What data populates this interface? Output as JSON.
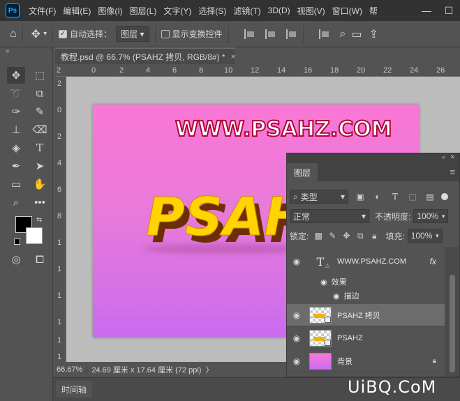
{
  "app": {
    "logo_text": "Ps"
  },
  "menubar": {
    "items": [
      "文件(F)",
      "编辑(E)",
      "图像(I)",
      "图层(L)",
      "文字(Y)",
      "选择(S)",
      "滤镜(T)",
      "3D(D)",
      "视图(V)",
      "窗口(W)",
      "帮"
    ],
    "window_controls": {
      "minimize": "—",
      "maximize": "☐"
    }
  },
  "options": {
    "home_icon": "home-icon",
    "move_icon": "move-icon",
    "auto_select_label": "自动选择：",
    "auto_select_checked": true,
    "auto_select_target": "图层",
    "show_transform_label": "显示变换控件",
    "show_transform_checked": false
  },
  "document": {
    "tab_title": "教程.psd @ 66.7% (PSAHZ 拷贝, RGB/8#) *",
    "close_glyph": "×",
    "ruler_top": [
      "2",
      "0",
      "2",
      "4",
      "6",
      "8",
      "10",
      "12",
      "14",
      "16",
      "18",
      "20",
      "22",
      "24",
      "26"
    ],
    "ruler_left": [
      "2",
      "0",
      "2",
      "4",
      "6",
      "8",
      "1",
      "1",
      "1",
      "1",
      "1",
      "1"
    ],
    "canvas": {
      "web_text": "WWW.PSAHZ.COM",
      "logo_text": "PSAHZ",
      "colors": {
        "pink_top": "#fa78d6",
        "purple_bottom": "#ca6bef",
        "gold": "#ffd400",
        "stroke": "#b0053a"
      }
    }
  },
  "status": {
    "zoom": "66.67%",
    "dimensions": "24.69 厘米 x 17.64 厘米 (72 ppi)",
    "arrow": "〉"
  },
  "timeline": {
    "tab_label": "时间轴"
  },
  "layers_panel": {
    "tab_label": "图层",
    "filter_kind": "类型",
    "blend_mode": "正常",
    "opacity_label": "不透明度:",
    "opacity_value": "100%",
    "lock_label": "锁定:",
    "fill_label": "填充:",
    "fill_value": "100%",
    "layers": [
      {
        "name": "WWW.PSAHZ.COM",
        "kind": "text",
        "visible": true,
        "fx": "fx",
        "effects_label": "效果",
        "effect_items": [
          "描边"
        ]
      },
      {
        "name": "PSAHZ 拷贝",
        "kind": "smart",
        "visible": true,
        "selected": true
      },
      {
        "name": "PSAHZ",
        "kind": "smart",
        "visible": true
      },
      {
        "name": "背景",
        "kind": "fill",
        "visible": true,
        "locked": true
      }
    ]
  },
  "watermark": "UiBQ.CoM"
}
